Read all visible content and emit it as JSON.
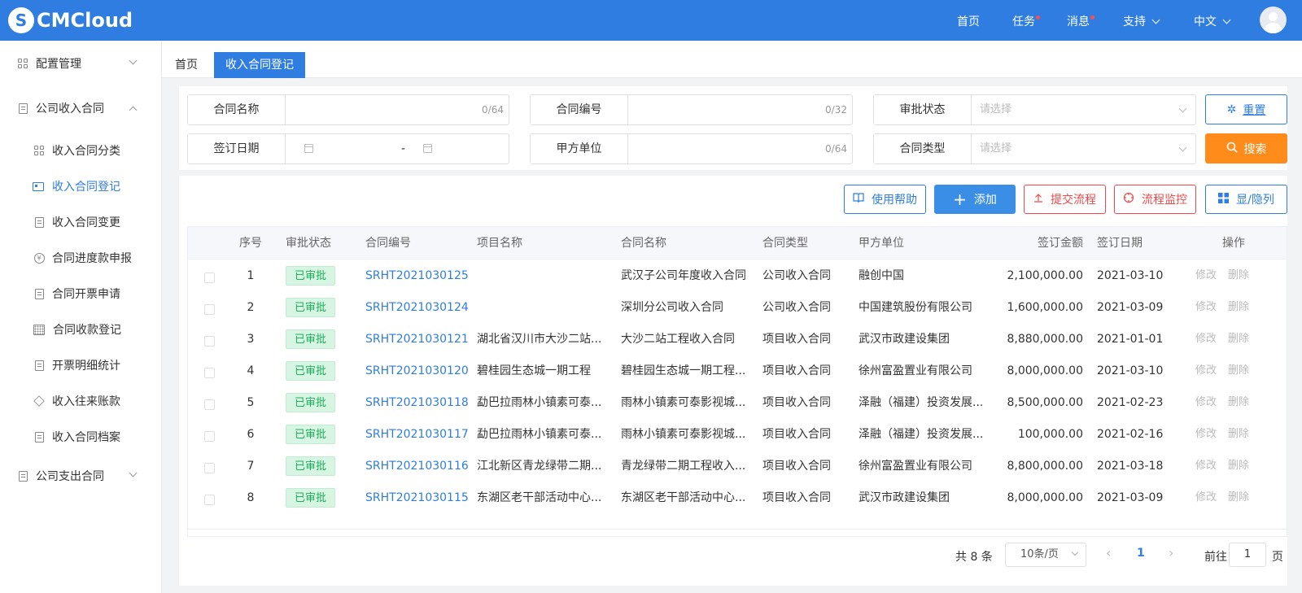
{
  "header": {
    "logo_mark": "S",
    "logo_text": "CMCloud",
    "nav": {
      "home": "首页",
      "tasks": "任务",
      "messages": "消息",
      "support": "支持",
      "language": "中文"
    }
  },
  "sidebar": {
    "groups": [
      {
        "label": "配置管理",
        "icon": "grid-icon",
        "expanded": false
      },
      {
        "label": "公司收入合同",
        "icon": "contract-icon",
        "expanded": true
      },
      {
        "label": "公司支出合同",
        "icon": "contract-icon",
        "expanded": false
      }
    ],
    "items": [
      {
        "label": "收入合同分类",
        "icon": "grid-icon"
      },
      {
        "label": "收入合同登记",
        "icon": "card-icon",
        "active": true
      },
      {
        "label": "收入合同变更",
        "icon": "document-icon"
      },
      {
        "label": "合同进度款申报",
        "icon": "yen-coin-icon"
      },
      {
        "label": "合同开票申请",
        "icon": "document-icon"
      },
      {
        "label": "合同收款登记",
        "icon": "calendar-grid-icon"
      },
      {
        "label": "开票明细统计",
        "icon": "building-icon"
      },
      {
        "label": "收入往来账款",
        "icon": "box-icon"
      },
      {
        "label": "收入合同档案",
        "icon": "archive-icon"
      }
    ]
  },
  "tabs": {
    "home": "首页",
    "active": "收入合同登记"
  },
  "search": {
    "contract_name": {
      "label": "合同名称",
      "counter": "0/64"
    },
    "contract_code": {
      "label": "合同编号",
      "counter": "0/32"
    },
    "approval_status": {
      "label": "审批状态",
      "placeholder": "请选择"
    },
    "sign_date": {
      "label": "签订日期",
      "separator": "-"
    },
    "party_a": {
      "label": "甲方单位",
      "counter": "0/64"
    },
    "contract_type": {
      "label": "合同类型",
      "placeholder": "请选择"
    },
    "reset_label": "重置",
    "search_label": "搜索"
  },
  "toolbar": {
    "help": "使用帮助",
    "add": "添加",
    "submit_flow": "提交流程",
    "flow_monitor": "流程监控",
    "show_hide": "显/隐列"
  },
  "table": {
    "columns": [
      "序号",
      "审批状态",
      "合同编号",
      "项目名称",
      "合同名称",
      "合同类型",
      "甲方单位",
      "签订金额",
      "签订日期",
      "操作"
    ],
    "rows": [
      {
        "no": "1",
        "status": "已审批",
        "code": "SRHT2021030125",
        "project": "",
        "name": "武汉子公司年度收入合同",
        "type": "公司收入合同",
        "party": "融创中国",
        "amount": "2,100,000.00",
        "date": "2021-03-10",
        "edit": "修改",
        "delete": "删除"
      },
      {
        "no": "2",
        "status": "已审批",
        "code": "SRHT2021030124",
        "project": "",
        "name": "深圳分公司收入合同",
        "type": "公司收入合同",
        "party": "中国建筑股份有限公司",
        "amount": "1,600,000.00",
        "date": "2021-03-09",
        "edit": "修改",
        "delete": "删除"
      },
      {
        "no": "3",
        "status": "已审批",
        "code": "SRHT2021030121",
        "project": "湖北省汉川市大沙二站...",
        "name": "大沙二站工程收入合同",
        "type": "项目收入合同",
        "party": "武汉市政建设集团",
        "amount": "8,880,000.00",
        "date": "2021-01-01",
        "edit": "修改",
        "delete": "删除"
      },
      {
        "no": "4",
        "status": "已审批",
        "code": "SRHT2021030120",
        "project": "碧桂园生态城一期工程",
        "name": "碧桂园生态城一期工程...",
        "type": "项目收入合同",
        "party": "徐州富盈置业有限公司",
        "amount": "8,000,000.00",
        "date": "2021-03-10",
        "edit": "修改",
        "delete": "删除"
      },
      {
        "no": "5",
        "status": "已审批",
        "code": "SRHT2021030118",
        "project": "勐巴拉雨林小镇素可泰...",
        "name": "雨林小镇素可泰影视城...",
        "type": "项目收入合同",
        "party": "泽融（福建）投资发展...",
        "amount": "8,500,000.00",
        "date": "2021-02-23",
        "edit": "修改",
        "delete": "删除"
      },
      {
        "no": "6",
        "status": "已审批",
        "code": "SRHT2021030117",
        "project": "勐巴拉雨林小镇素可泰...",
        "name": "雨林小镇素可泰影视城...",
        "type": "项目收入合同",
        "party": "泽融（福建）投资发展...",
        "amount": "100,000.00",
        "date": "2021-02-16",
        "edit": "修改",
        "delete": "删除"
      },
      {
        "no": "7",
        "status": "已审批",
        "code": "SRHT2021030116",
        "project": "江北新区青龙绿带二期...",
        "name": "青龙绿带二期工程收入...",
        "type": "项目收入合同",
        "party": "徐州富盈置业有限公司",
        "amount": "8,800,000.00",
        "date": "2021-03-18",
        "edit": "修改",
        "delete": "删除"
      },
      {
        "no": "8",
        "status": "已审批",
        "code": "SRHT2021030115",
        "project": "东湖区老干部活动中心...",
        "name": "东湖区老干部活动中心...",
        "type": "项目收入合同",
        "party": "武汉市政建设集团",
        "amount": "8,000,000.00",
        "date": "2021-03-09",
        "edit": "修改",
        "delete": "删除"
      }
    ]
  },
  "pagination": {
    "total": "共 8 条",
    "page_size": "10条/页",
    "current": "1",
    "goto_label": "前往",
    "goto_value": "1",
    "goto_suffix": "页"
  },
  "colors": {
    "brand": "#2f7de1",
    "search_button": "#ff8c1a",
    "danger": "#f04848",
    "approved_badge": "#1fae5a"
  }
}
